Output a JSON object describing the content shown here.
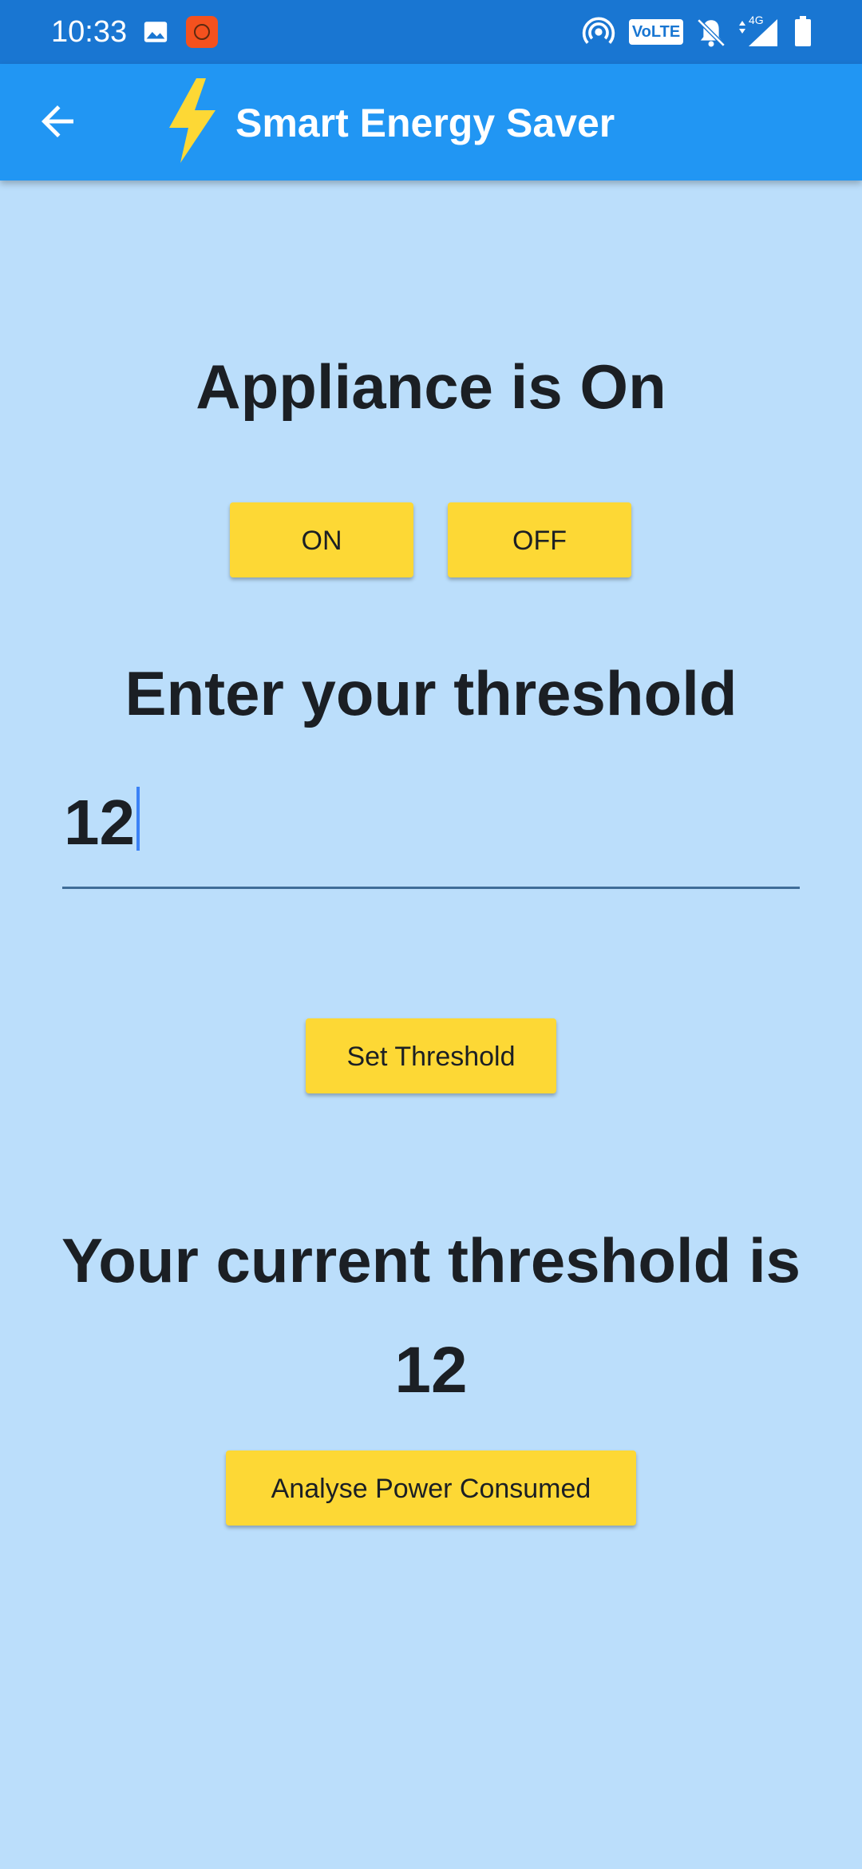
{
  "status_bar": {
    "time": "10:33",
    "volte": "VoLTE",
    "network": "4G"
  },
  "app_bar": {
    "title": "Smart Energy Saver",
    "back_icon": "arrow-back-icon",
    "logo_icon": "lightning-bolt-icon"
  },
  "appliance": {
    "status_text": "Appliance is On",
    "on_label": "ON",
    "off_label": "OFF"
  },
  "threshold": {
    "heading": "Enter your threshold",
    "input_value": "12",
    "set_label": "Set Threshold"
  },
  "current": {
    "heading": "Your current threshold is",
    "value": "12"
  },
  "analyse": {
    "label": "Analyse Power Consumed"
  },
  "colors": {
    "status_bar": "#1976D2",
    "app_bar": "#2196F3",
    "background": "#BBDEFB",
    "button": "#FDD835",
    "bolt": "#FDD835"
  }
}
